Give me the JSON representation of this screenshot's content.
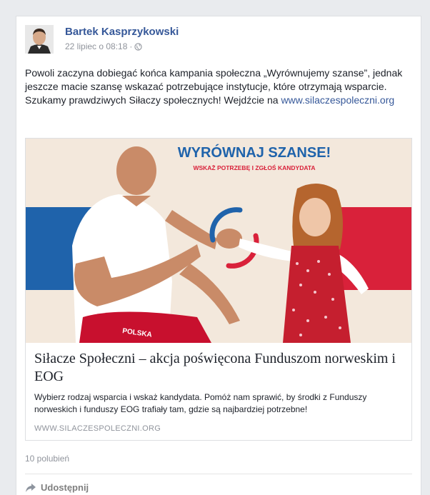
{
  "post": {
    "author": "Bartek Kasprzykowski",
    "date": "22 lipiec o 08:18",
    "separator": "·",
    "privacy_icon": "globe-icon",
    "text_main": "Powoli zaczyna dobiegać końca kampania społeczna „Wyrównujemy szanse”, jednak jeszcze macie szansę wskazać potrzebujące instytucje, które otrzymają wsparcie. Szukamy prawdziwych Siłaczy społecznych! Wejdźcie na ",
    "text_link": "www.silaczespoleczni.org"
  },
  "attachment": {
    "banner_title": "WYRÓWNAJ SZANSE!",
    "banner_subtitle": "WSKAŻ POTRZEBĘ I ZGŁOŚ KANDYDATA",
    "shorts_text": "POLSKA",
    "title": "Siłacze Społeczni – akcja poświęcona Funduszom norweskim i EOG",
    "description": "Wybierz rodzaj wsparcia i wskaż kandydata. Pomóż nam sprawić, by środki z Funduszy norweskich i funduszy EOG trafiały tam, gdzie są najbardziej potrzebne!",
    "domain": "WWW.SILACZESPOLECZNI.ORG"
  },
  "footer": {
    "likes": "10 polubień",
    "share_label": "Udostępnij",
    "share_icon": "share-arrow-icon"
  },
  "colors": {
    "author_link": "#365899",
    "banner_blue": "#1f63ab",
    "banner_red": "#d9213a",
    "muted": "#90949c"
  }
}
